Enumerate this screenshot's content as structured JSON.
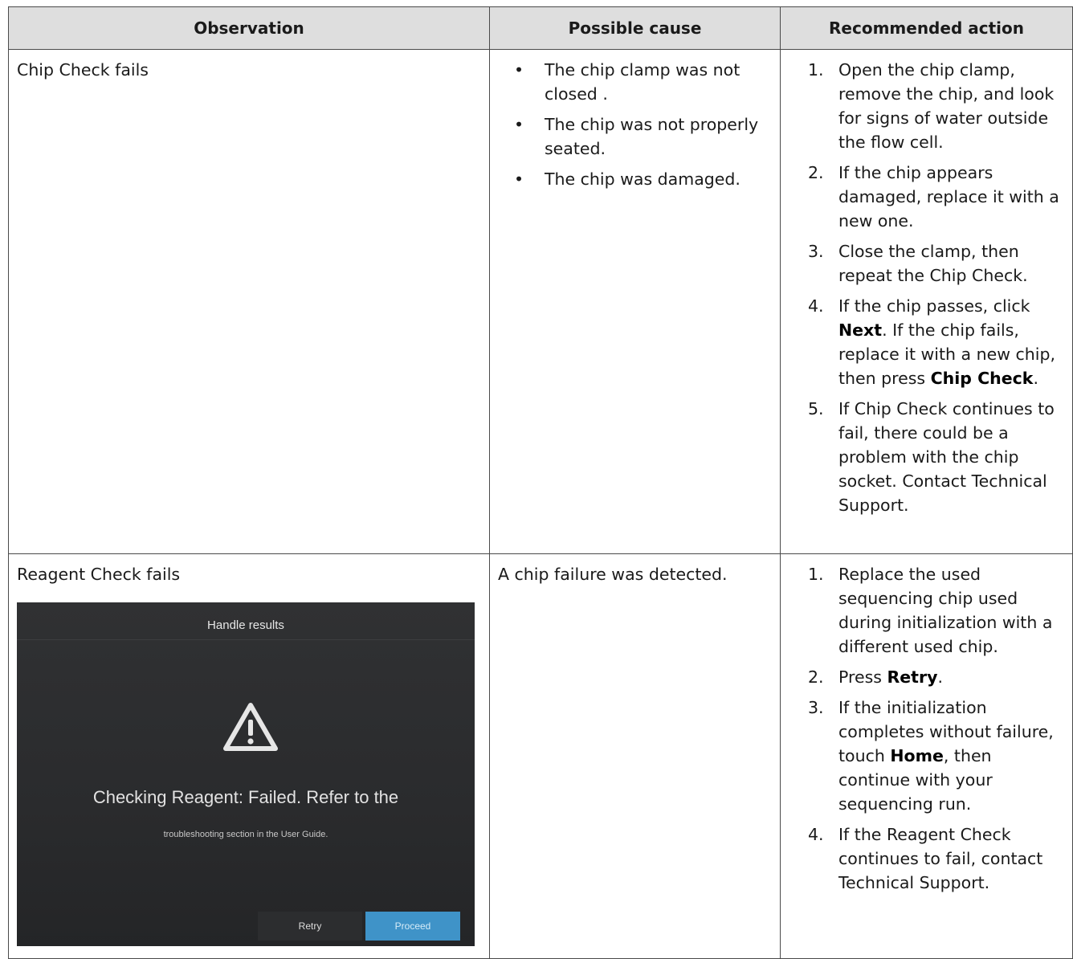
{
  "table": {
    "headers": [
      "Observation",
      "Possible cause",
      "Recommended action"
    ],
    "rows": [
      {
        "observation": "Chip Check fails",
        "causes": [
          "The chip clamp was not closed .",
          "The chip was not properly seated.",
          "The chip was damaged."
        ],
        "actions": [
          {
            "num": "1.",
            "parts": [
              "Open the chip clamp, remove the chip, and look for signs of water outside the flow cell."
            ]
          },
          {
            "num": "2.",
            "parts": [
              "If the chip appears damaged, replace it with a new one."
            ]
          },
          {
            "num": "3.",
            "parts": [
              "Close the clamp, then repeat the Chip Check."
            ]
          },
          {
            "num": "4.",
            "parts": [
              "If the chip passes, click ",
              "Next",
              ". If the chip fails, replace it with a new chip, then press ",
              "Chip Check",
              "."
            ]
          },
          {
            "num": "5.",
            "parts": [
              "If Chip Check continues to fail, there could be a problem with the chip socket. Contact Technical Support."
            ]
          }
        ]
      },
      {
        "observation": "Reagent Check fails",
        "cause_text": "A chip failure was detected.",
        "actions": [
          {
            "num": "1.",
            "parts": [
              "Replace the used sequencing chip used during initialization with a different used chip."
            ]
          },
          {
            "num": "2.",
            "parts": [
              "Press ",
              "Retry",
              "."
            ]
          },
          {
            "num": "3.",
            "parts": [
              "If the initialization completes without failure, touch ",
              "Home",
              ", then continue with your sequencing run."
            ]
          },
          {
            "num": "4.",
            "parts": [
              "If the Reagent Check continues to fail, contact Technical Support."
            ]
          }
        ],
        "screenshot": {
          "title": "Handle results",
          "icon": "warning-triangle-icon",
          "message": "Checking Reagent: Failed. Refer to the",
          "submessage": "troubleshooting section in the User Guide.",
          "retry_label": "Retry",
          "proceed_label": "Proceed",
          "accent_color": "#3f93c8"
        }
      }
    ]
  }
}
